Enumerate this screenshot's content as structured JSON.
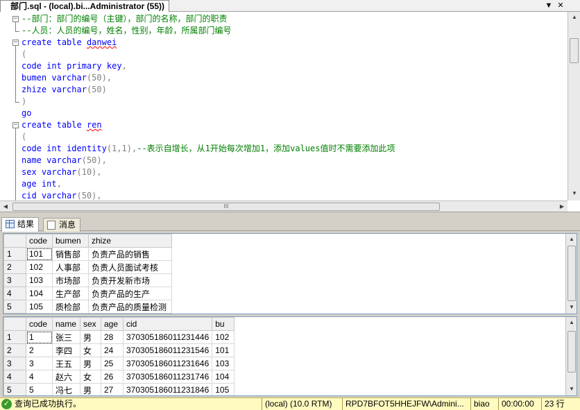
{
  "document_tab": {
    "title": "部门.sql - (local).bi...Administrator (55))",
    "dropdown_glyph": "▼",
    "close_glyph": "✕"
  },
  "editor": {
    "lines": [
      {
        "fold": "minus",
        "parts": [
          {
            "t": "--部门：部门的编号（主键），部门的名称，部门的职责",
            "c": "cm"
          }
        ]
      },
      {
        "fold": "end",
        "parts": [
          {
            "t": "--人员：人员的编号，姓名，性别，年龄，所属部门编号",
            "c": "cm"
          }
        ]
      },
      {
        "fold": "minus",
        "parts": [
          {
            "t": "create",
            "c": "kw"
          },
          {
            "t": " ",
            "c": ""
          },
          {
            "t": "table",
            "c": "kw"
          },
          {
            "t": " ",
            "c": ""
          },
          {
            "t": "danwei",
            "c": "squig"
          }
        ]
      },
      {
        "fold": "line",
        "parts": [
          {
            "t": "(",
            "c": "gy"
          }
        ]
      },
      {
        "fold": "line",
        "parts": [
          {
            "t": "code",
            "c": "kw"
          },
          {
            "t": " ",
            "c": ""
          },
          {
            "t": "int",
            "c": "kw"
          },
          {
            "t": " ",
            "c": ""
          },
          {
            "t": "primary",
            "c": "kw"
          },
          {
            "t": " ",
            "c": ""
          },
          {
            "t": "key",
            "c": "kw"
          },
          {
            "t": ",",
            "c": "gy"
          }
        ]
      },
      {
        "fold": "line",
        "parts": [
          {
            "t": "bumen",
            "c": "kw"
          },
          {
            "t": " ",
            "c": ""
          },
          {
            "t": "varchar",
            "c": "kw"
          },
          {
            "t": "(50),",
            "c": "gy"
          }
        ]
      },
      {
        "fold": "line",
        "parts": [
          {
            "t": "zhize",
            "c": "kw"
          },
          {
            "t": " ",
            "c": ""
          },
          {
            "t": "varchar",
            "c": "kw"
          },
          {
            "t": "(50)",
            "c": "gy"
          }
        ]
      },
      {
        "fold": "end",
        "parts": [
          {
            "t": ")",
            "c": "gy"
          }
        ]
      },
      {
        "fold": "none",
        "parts": [
          {
            "t": "go",
            "c": "kw"
          }
        ]
      },
      {
        "fold": "minus",
        "parts": [
          {
            "t": "create",
            "c": "kw"
          },
          {
            "t": " ",
            "c": ""
          },
          {
            "t": "table",
            "c": "kw"
          },
          {
            "t": " ",
            "c": ""
          },
          {
            "t": "ren",
            "c": "squig"
          }
        ]
      },
      {
        "fold": "line",
        "parts": [
          {
            "t": "(",
            "c": "gy"
          }
        ]
      },
      {
        "fold": "line",
        "parts": [
          {
            "t": "code",
            "c": "kw"
          },
          {
            "t": " ",
            "c": ""
          },
          {
            "t": "int",
            "c": "kw"
          },
          {
            "t": " ",
            "c": ""
          },
          {
            "t": "identity",
            "c": "kw"
          },
          {
            "t": "(1,1),",
            "c": "gy"
          },
          {
            "t": "--表示自增长，从1开始每次增加1，添加values值时不需要添加此项",
            "c": "cm"
          }
        ]
      },
      {
        "fold": "line",
        "parts": [
          {
            "t": "name",
            "c": "kw"
          },
          {
            "t": " ",
            "c": ""
          },
          {
            "t": "varchar",
            "c": "kw"
          },
          {
            "t": "(50),",
            "c": "gy"
          }
        ]
      },
      {
        "fold": "line",
        "parts": [
          {
            "t": "sex",
            "c": "kw"
          },
          {
            "t": " ",
            "c": ""
          },
          {
            "t": "varchar",
            "c": "kw"
          },
          {
            "t": "(10),",
            "c": "gy"
          }
        ]
      },
      {
        "fold": "line",
        "parts": [
          {
            "t": "age",
            "c": "kw"
          },
          {
            "t": " ",
            "c": ""
          },
          {
            "t": "int",
            "c": "kw"
          },
          {
            "t": ",",
            "c": "gy"
          }
        ]
      },
      {
        "fold": "line",
        "parts": [
          {
            "t": "cid",
            "c": "kw"
          },
          {
            "t": " ",
            "c": ""
          },
          {
            "t": "varchar",
            "c": "kw"
          },
          {
            "t": "(50),",
            "c": "gy"
          }
        ]
      }
    ],
    "hscroll_grip": "III"
  },
  "result_tabs": [
    {
      "label": "结果",
      "active": true
    },
    {
      "label": "消息",
      "active": false
    }
  ],
  "grid1": {
    "headers": [
      "code",
      "bumen",
      "zhize"
    ],
    "rows": [
      [
        "1",
        "101",
        "销售部",
        "负责产品的销售"
      ],
      [
        "2",
        "102",
        "人事部",
        "负责人员面试考核"
      ],
      [
        "3",
        "103",
        "市场部",
        "负责开发新市场"
      ],
      [
        "4",
        "104",
        "生产部",
        "负责产品的生产"
      ],
      [
        "5",
        "105",
        "质检部",
        "负责产品的质量检测"
      ]
    ]
  },
  "grid2": {
    "headers": [
      "code",
      "name",
      "sex",
      "age",
      "cid",
      "bu"
    ],
    "rows": [
      [
        "1",
        "1",
        "张三",
        "男",
        "28",
        "370305186011231446",
        "102"
      ],
      [
        "2",
        "2",
        "李四",
        "女",
        "24",
        "370305186011231546",
        "101"
      ],
      [
        "3",
        "3",
        "王五",
        "男",
        "25",
        "370305186011231646",
        "103"
      ],
      [
        "4",
        "4",
        "赵六",
        "女",
        "26",
        "370305186011231746",
        "104"
      ],
      [
        "5",
        "5",
        "冯七",
        "男",
        "27",
        "370305186011231846",
        "105"
      ]
    ]
  },
  "status": {
    "message": "查询已成功执行。",
    "check_glyph": "✓",
    "server": "(local) (10.0 RTM)",
    "user": "RPD7BFOT5HHEJFW\\Admini...",
    "database": "biao",
    "elapsed": "00:00:00",
    "rows": "23 行"
  },
  "scroll_arrows": {
    "up": "▲",
    "down": "▼",
    "left": "◀",
    "right": "▶"
  }
}
